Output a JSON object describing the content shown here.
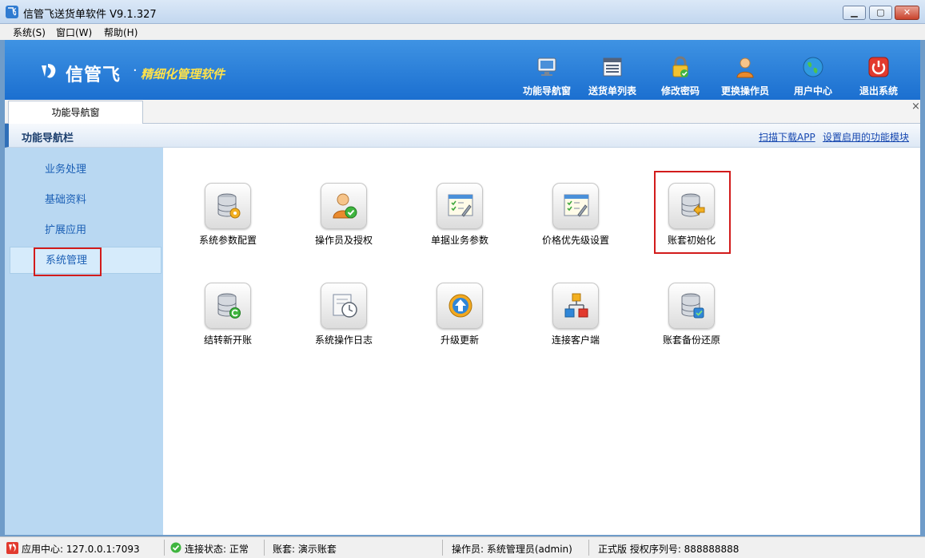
{
  "window": {
    "title": "信管飞送货单软件 V9.1.327",
    "app_icon": "app-logo-icon"
  },
  "menu": [
    "系统(S)",
    "窗口(W)",
    "帮助(H)"
  ],
  "banner": {
    "brand": "信管飞",
    "dot": "·",
    "slogan": "精细化管理软件",
    "toolbar": [
      {
        "label": "功能导航窗",
        "icon": "monitor-icon"
      },
      {
        "label": "送货单列表",
        "icon": "list-icon"
      },
      {
        "label": "修改密码",
        "icon": "lock-icon"
      },
      {
        "label": "更换操作员",
        "icon": "user-icon"
      },
      {
        "label": "用户中心",
        "icon": "globe-icon"
      },
      {
        "label": "退出系统",
        "icon": "power-icon"
      }
    ]
  },
  "tabs": {
    "active": "功能导航窗",
    "close": "×"
  },
  "nav_header": {
    "title": "功能导航栏",
    "link_scan": "扫描下载APP",
    "link_modules": "设置启用的功能模块"
  },
  "sidebar": {
    "items": [
      "业务处理",
      "基础资料",
      "扩展应用",
      "系统管理"
    ],
    "active_index": 3
  },
  "tiles": [
    {
      "label": "系统参数配置",
      "icon": "database-gear-icon"
    },
    {
      "label": "操作员及授权",
      "icon": "user-check-icon"
    },
    {
      "label": "单据业务参数",
      "icon": "form-settings-icon"
    },
    {
      "label": "价格优先级设置",
      "icon": "form-settings-icon"
    },
    {
      "label": "账套初始化",
      "icon": "database-arrow-icon"
    },
    {
      "label": "结转新开账",
      "icon": "database-refresh-icon"
    },
    {
      "label": "系统操作日志",
      "icon": "log-clock-icon"
    },
    {
      "label": "升级更新",
      "icon": "upgrade-icon"
    },
    {
      "label": "连接客户端",
      "icon": "network-icon"
    },
    {
      "label": "账套备份还原",
      "icon": "database-backup-icon"
    }
  ],
  "highlighted_tile": "账套初始化",
  "status": {
    "app_center": "应用中心: 127.0.0.1:7093",
    "connection": "连接状态: 正常",
    "account": "账套: 演示账套",
    "operator": "操作员: 系统管理员(admin)",
    "license": "正式版  授权序列号: 888888888"
  },
  "colors": {
    "banner": "#2a7fd8",
    "slogan": "#ffe24a",
    "highlight": "#d21b1b",
    "sidebar": "#b9d8f2"
  }
}
